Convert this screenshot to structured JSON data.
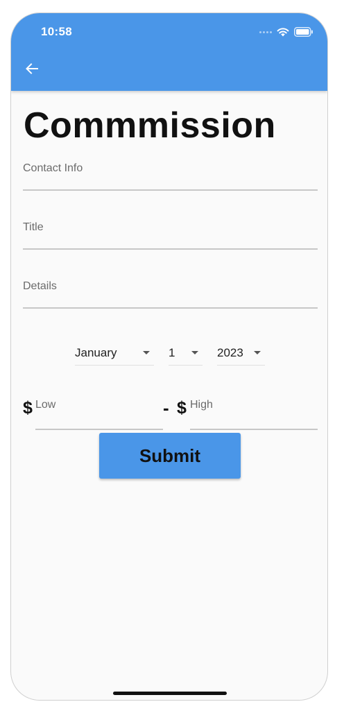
{
  "status_bar": {
    "time": "10:58",
    "icons": [
      "cellular-dots-icon",
      "wifi-icon",
      "battery-icon"
    ]
  },
  "app_bar": {
    "back_icon": "arrow-left-icon",
    "color": "#4a96e8"
  },
  "page": {
    "title": "Commmission"
  },
  "form": {
    "contact_info": {
      "placeholder": "Contact Info",
      "value": ""
    },
    "title": {
      "placeholder": "Title",
      "value": ""
    },
    "details": {
      "placeholder": "Details",
      "value": ""
    },
    "date": {
      "month": "January",
      "day": "1",
      "year": "2023"
    },
    "price": {
      "currency_symbol": "$",
      "separator": "-",
      "low": {
        "placeholder": "Low",
        "value": ""
      },
      "high": {
        "placeholder": "High",
        "value": ""
      }
    },
    "submit_label": "Submit"
  }
}
